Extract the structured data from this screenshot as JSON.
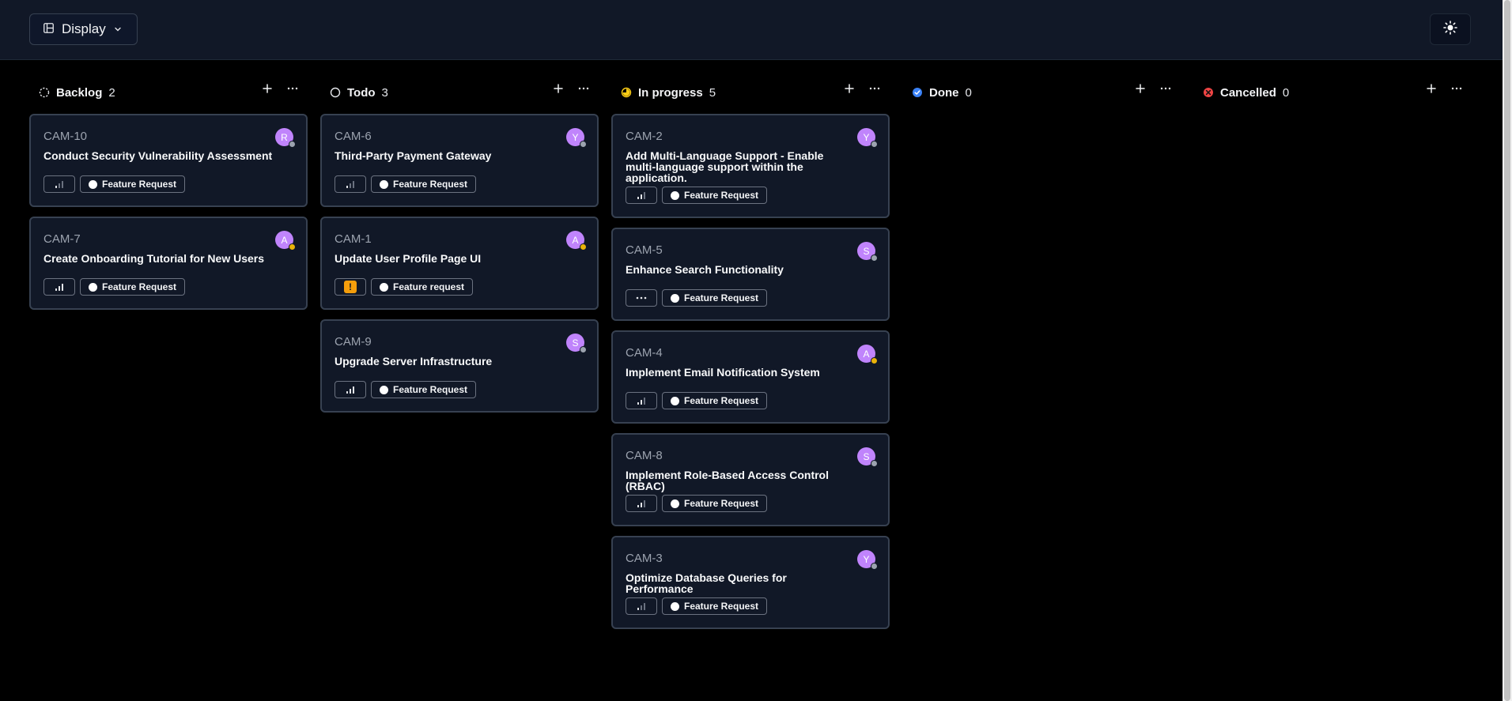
{
  "toolbar": {
    "display_label": "Display",
    "display_icon": "layout-icon",
    "theme_icon": "sun-icon"
  },
  "colors": {
    "background": "#000000",
    "topbar": "#111827",
    "card": "#111827",
    "card_border": "#374151",
    "avatar": "#c084fc",
    "in_progress": "#facc15",
    "done": "#3b82f6",
    "cancelled": "#ef4444",
    "urgent": "#f59e0b"
  },
  "columns": [
    {
      "title": "Backlog",
      "count": "2",
      "status_icon": "dashed-circle-icon",
      "cards": [
        {
          "id": "CAM-10",
          "title": "Conduct Security Vulnerability Assessment",
          "avatar": "R",
          "avatar_status": "#9ca3af",
          "priority": "low",
          "label": "Feature Request"
        },
        {
          "id": "CAM-7",
          "title": "Create Onboarding Tutorial for New Users",
          "avatar": "A",
          "avatar_status": "#eab308",
          "priority": "high",
          "label": "Feature Request"
        }
      ]
    },
    {
      "title": "Todo",
      "count": "3",
      "status_icon": "circle-icon",
      "cards": [
        {
          "id": "CAM-6",
          "title": "Third-Party Payment Gateway",
          "avatar": "Y",
          "avatar_status": "#9ca3af",
          "priority": "low",
          "label": "Feature Request"
        },
        {
          "id": "CAM-1",
          "title": "Update User Profile Page UI",
          "avatar": "A",
          "avatar_status": "#eab308",
          "priority": "urgent",
          "label": "Feature request"
        },
        {
          "id": "CAM-9",
          "title": "Upgrade Server Infrastructure",
          "avatar": "S",
          "avatar_status": "#9ca3af",
          "priority": "high",
          "label": "Feature Request"
        }
      ]
    },
    {
      "title": "In progress",
      "count": "5",
      "status_icon": "half-circle-icon",
      "cards": [
        {
          "id": "CAM-2",
          "title": "Add Multi-Language Support - Enable multi-language support within the application.",
          "avatar": "Y",
          "avatar_status": "#9ca3af",
          "priority": "medium",
          "label": "Feature Request"
        },
        {
          "id": "CAM-5",
          "title": "Enhance Search Functionality",
          "avatar": "S",
          "avatar_status": "#9ca3af",
          "priority": "none",
          "label": "Feature Request"
        },
        {
          "id": "CAM-4",
          "title": "Implement Email Notification System",
          "avatar": "A",
          "avatar_status": "#eab308",
          "priority": "medium",
          "label": "Feature Request"
        },
        {
          "id": "CAM-8",
          "title": "Implement Role-Based Access Control (RBAC)",
          "avatar": "S",
          "avatar_status": "#9ca3af",
          "priority": "medium",
          "label": "Feature Request"
        },
        {
          "id": "CAM-3",
          "title": "Optimize Database Queries for Performance",
          "avatar": "Y",
          "avatar_status": "#9ca3af",
          "priority": "low",
          "label": "Feature Request"
        }
      ]
    },
    {
      "title": "Done",
      "count": "0",
      "status_icon": "check-circle-icon",
      "cards": []
    },
    {
      "title": "Cancelled",
      "count": "0",
      "status_icon": "x-circle-icon",
      "cards": []
    }
  ]
}
